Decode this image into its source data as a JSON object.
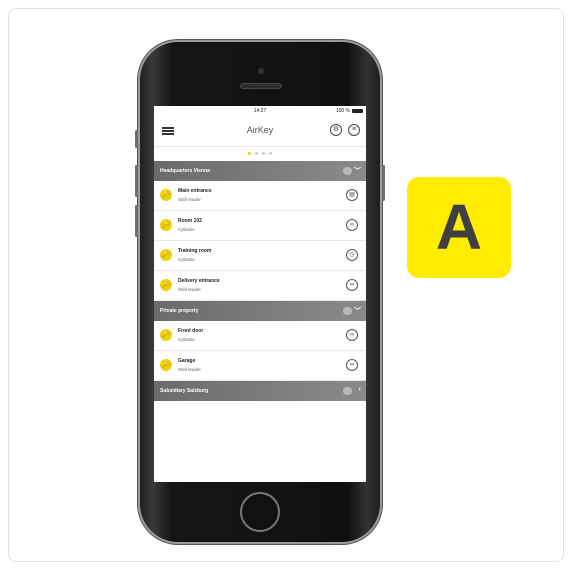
{
  "status_bar": {
    "time": "14:27",
    "battery": "100 %"
  },
  "app": {
    "title": "AirKey",
    "menu_icon": "hamburger-icon",
    "settings_icon": "gear-icon",
    "more_icon": "menu-circle-icon"
  },
  "pager": {
    "total": 4,
    "active": 1
  },
  "sections": [
    {
      "label": "Headquarters Vienna",
      "expanded": true,
      "items": [
        {
          "name": "Main entrance",
          "type": "Wall reader",
          "action_icon": "wall-reader-icon"
        },
        {
          "name": "Room 102",
          "type": "Cylinder",
          "action_icon": "cylinder-icon"
        },
        {
          "name": "Training room",
          "type": "Cylinder",
          "action_icon": "clock-icon"
        },
        {
          "name": "Delivery entrance",
          "type": "Wall reader",
          "action_icon": "cylinder-icon"
        }
      ]
    },
    {
      "label": "Private property",
      "expanded": true,
      "items": [
        {
          "name": "Front door",
          "type": "Cylinder",
          "action_icon": "cylinder-icon"
        },
        {
          "name": "Garage",
          "type": "Wall reader",
          "action_icon": "cylinder-icon"
        }
      ]
    },
    {
      "label": "Subsidiary Salzburg",
      "expanded": false,
      "items": []
    }
  ],
  "brand": {
    "letter": "A",
    "color": "#ffec00"
  }
}
